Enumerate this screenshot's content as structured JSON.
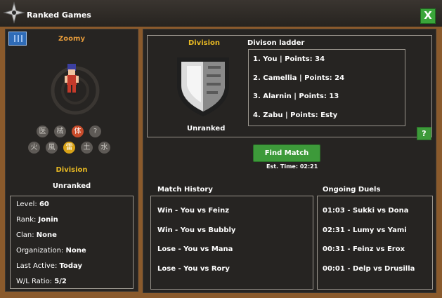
{
  "window": {
    "title": "Ranked Games",
    "close_label": "X"
  },
  "profile": {
    "name": "Zoomy",
    "division_label": "Division",
    "division_value": "Unranked",
    "elements_row1": [
      {
        "glyph": "医",
        "icon": "medical-element-icon",
        "active": false
      },
      {
        "glyph": "械",
        "icon": "tool-element-icon",
        "active": false
      },
      {
        "glyph": "体",
        "icon": "body-element-icon",
        "active": true
      },
      {
        "glyph": "?",
        "icon": "unknown-element-icon",
        "active": false
      }
    ],
    "elements_row2": [
      {
        "glyph": "火",
        "icon": "fire-element-icon",
        "active": false
      },
      {
        "glyph": "風",
        "icon": "wind-element-icon",
        "active": false
      },
      {
        "glyph": "雷",
        "icon": "lightning-element-icon",
        "active": true
      },
      {
        "glyph": "土",
        "icon": "earth-element-icon",
        "active": false
      },
      {
        "glyph": "水",
        "icon": "water-element-icon",
        "active": false
      }
    ],
    "stats": [
      {
        "label": "Level:",
        "value": "60"
      },
      {
        "label": "Rank:",
        "value": "Jonin"
      },
      {
        "label": "Clan:",
        "value": "None"
      },
      {
        "label": "Organization:",
        "value": "None"
      },
      {
        "label": "Last Active:",
        "value": "Today"
      },
      {
        "label": "W/L Ratio:",
        "value": "5/2"
      }
    ]
  },
  "division_card": {
    "title": "Division",
    "value": "Unranked",
    "ladder_title": "Divison ladder",
    "ladder": [
      "1. You | Points: 34",
      "2. Camellia | Points: 24",
      "3. Alarnin | Points: 13",
      "4. Zabu | Points: Esty"
    ],
    "help_label": "?"
  },
  "find_match": {
    "label": "Find Match",
    "est_time": "Est. Time: 02:21"
  },
  "match_history": {
    "title": "Match History",
    "items": [
      "Win - You vs Feinz",
      "Win - You vs Bubbly",
      "Lose - You vs Mana",
      "Lose - You vs Rory"
    ]
  },
  "ongoing_duels": {
    "title": "Ongoing Duels",
    "items": [
      "01:03 - Sukki vs Dona",
      "02:31 - Lumy vs Yami",
      "00:31 - Feinz vs Erox",
      "00:01 - Delp vs Drusilla"
    ]
  },
  "colors": {
    "frame": "#8a5a2c",
    "panel": "#262422",
    "accent_gold": "#e8b923",
    "button_green": "#3d9a3a",
    "name_orange": "#e39a3b"
  }
}
